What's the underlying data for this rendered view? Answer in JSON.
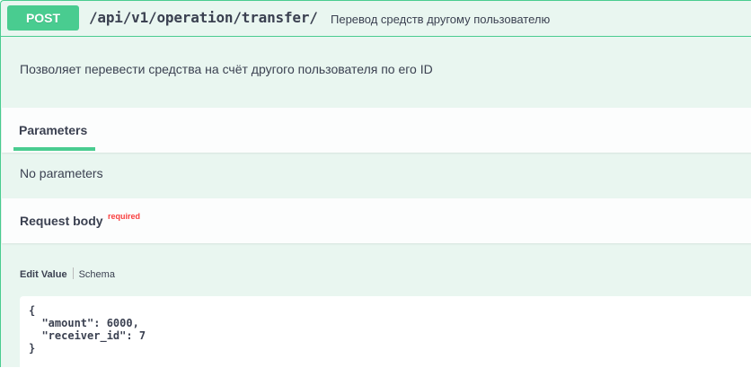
{
  "operation": {
    "method": "POST",
    "path": "/api/v1/operation/transfer/",
    "summary": "Перевод средств другому пользователю",
    "description": "Позволяет перевести средства на счёт другого пользователя по его ID"
  },
  "parameters": {
    "tab_label": "Parameters",
    "empty_text": "No parameters"
  },
  "request_body": {
    "title": "Request body",
    "required_label": "required",
    "tabs": [
      "Edit Value",
      "Schema"
    ],
    "example_json": "{\n  \"amount\": 6000,\n  \"receiver_id\": 7\n}"
  },
  "colors": {
    "method_post": "#49cc90",
    "block_bg": "#e9f6f0",
    "required": "#f93e3e"
  }
}
